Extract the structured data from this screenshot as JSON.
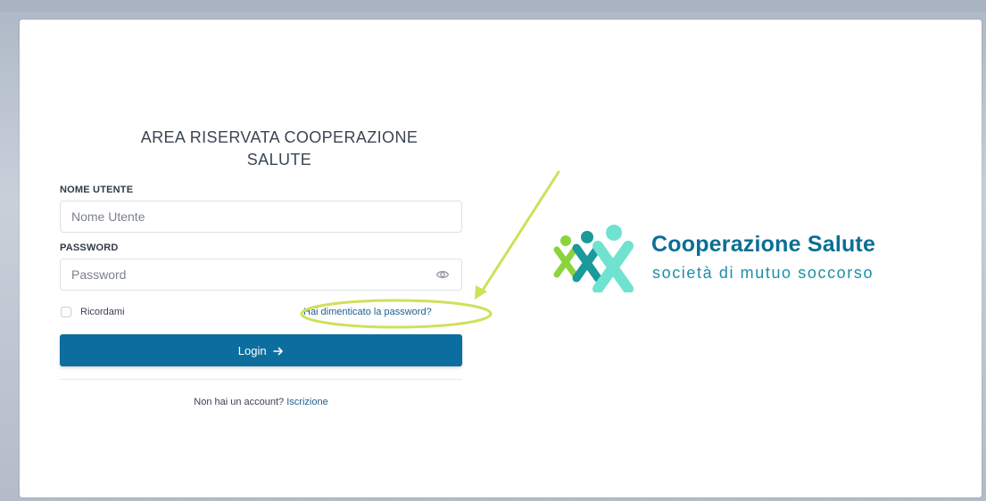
{
  "page": {
    "title_line1": "AREA RISERVATA COOPERAZIONE",
    "title_line2": "SALUTE"
  },
  "form": {
    "username_label": "NOME UTENTE",
    "username_placeholder": "Nome Utente",
    "username_value": "",
    "password_label": "PASSWORD",
    "password_placeholder": "Password",
    "password_value": "",
    "remember_label": "Ricordami",
    "remember_checked": false,
    "forgot_label": "Hai dimenticato la password?",
    "login_label": "Login",
    "login_icon": "arrow-right-icon",
    "signup_prompt": "Non hai un account?",
    "signup_link": "Iscrizione"
  },
  "logo": {
    "name": "Cooperazione Salute",
    "tagline": "società di mutuo soccorso",
    "colors": {
      "lime": "#8bd43c",
      "teal": "#1a9a9a",
      "mint": "#6fe3d0",
      "brand": "#0a6f94"
    }
  },
  "colors": {
    "primary_button": "#0b6e9f",
    "link": "#1f5f8f",
    "annotation": "#cfe05a"
  },
  "icons": {
    "password_toggle": "eye-icon"
  }
}
